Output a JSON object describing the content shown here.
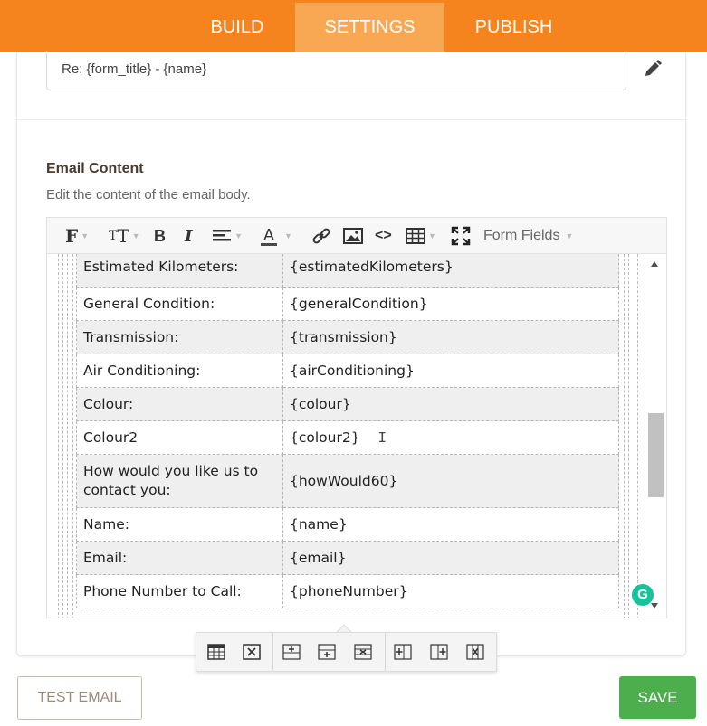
{
  "nav": {
    "tabs": [
      {
        "label": "BUILD",
        "active": false
      },
      {
        "label": "SETTINGS",
        "active": true
      },
      {
        "label": "PUBLISH",
        "active": false
      }
    ],
    "color": "#f5841f",
    "active_color": "#f8a753"
  },
  "subject": {
    "value": "Re: {form_title} - {name}"
  },
  "email_content": {
    "label": "Email Content",
    "description": "Edit the content of the email body."
  },
  "toolbar": {
    "font": "F",
    "font_size": "T",
    "bold": "B",
    "italic": "I",
    "font_color": "A",
    "code": "<>",
    "form_fields": "Form Fields"
  },
  "table_rows": [
    {
      "label": "Estimated Kilometers:",
      "value": "{estimatedKilometers}"
    },
    {
      "label": "General Condition:",
      "value": "{generalCondition}"
    },
    {
      "label": "Transmission:",
      "value": "{transmission}"
    },
    {
      "label": "Air Conditioning:",
      "value": "{airConditioning}"
    },
    {
      "label": "Colour:",
      "value": "{colour}"
    },
    {
      "label": "Colour2",
      "value": "{colour2}"
    },
    {
      "label": "How would you like us to contact you:",
      "value": "{howWould60}"
    },
    {
      "label": "Name:",
      "value": "{name}"
    },
    {
      "label": "Email:",
      "value": "{email}"
    },
    {
      "label": "Phone Number to Call:",
      "value": "{phoneNumber}"
    }
  ],
  "grammarly_icon": "G",
  "buttons": {
    "test_email": "TEST EMAIL",
    "save": "SAVE",
    "save_color": "#4cae4c"
  }
}
